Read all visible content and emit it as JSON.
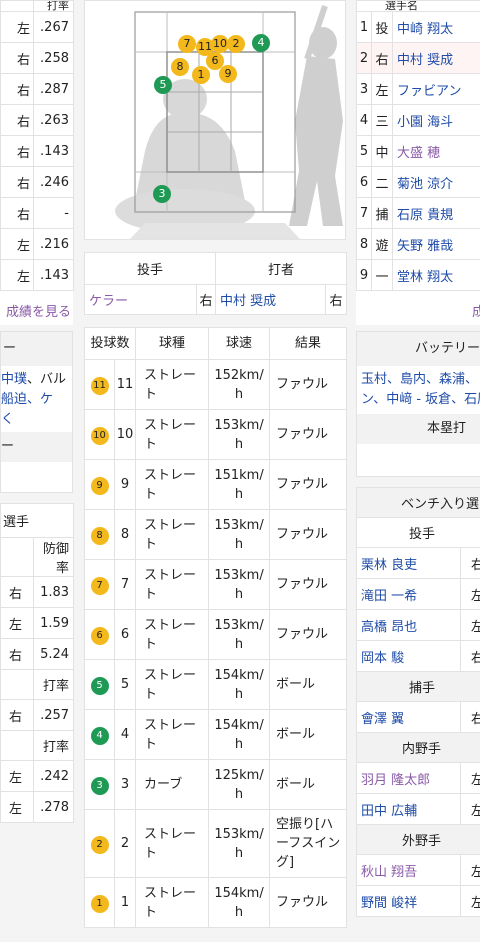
{
  "left_top": {
    "header": "打率",
    "rows": [
      {
        "hand": "左",
        "avg": ".267"
      },
      {
        "hand": "右",
        "avg": ".258"
      },
      {
        "hand": "右",
        "avg": ".287"
      },
      {
        "hand": "右",
        "avg": ".263"
      },
      {
        "hand": "右",
        "avg": ".143"
      },
      {
        "hand": "右",
        "avg": ".246"
      },
      {
        "hand": "右",
        "avg": "-"
      },
      {
        "hand": "左",
        "avg": ".216"
      },
      {
        "hand": "左",
        "avg": ".143"
      }
    ],
    "more": "成績を見る"
  },
  "left_battery": {
    "title": "ー",
    "line1_a": "中璞",
    "line1_b": "、バル",
    "line2": "船迫、ケ",
    "line3": "く",
    "line4": "ー"
  },
  "left_pitchers": {
    "title": "選手",
    "era_header": "防御率",
    "rows": [
      {
        "hand": "右",
        "val": "1.83"
      },
      {
        "hand": "左",
        "val": "1.59"
      },
      {
        "hand": "右",
        "val": "5.24"
      }
    ],
    "avg_header1": "打率",
    "rows2": [
      {
        "hand": "右",
        "val": ".257"
      }
    ],
    "avg_header2": "打率",
    "rows3": [
      {
        "hand": "左",
        "val": ".242"
      },
      {
        "hand": "左",
        "val": ".278"
      }
    ]
  },
  "zone": {
    "points": [
      {
        "n": "7",
        "c": "y"
      },
      {
        "n": "11",
        "c": "y"
      },
      {
        "n": "10",
        "c": "y"
      },
      {
        "n": "2",
        "c": "y"
      },
      {
        "n": "4",
        "c": "g"
      },
      {
        "n": "6",
        "c": "y"
      },
      {
        "n": "8",
        "c": "y"
      },
      {
        "n": "1",
        "c": "y"
      },
      {
        "n": "9",
        "c": "y"
      },
      {
        "n": "5",
        "c": "g"
      },
      {
        "n": "3",
        "c": "g"
      }
    ]
  },
  "matchup": {
    "pitcher_h": "投手",
    "batter_h": "打者",
    "pitcher": "ケラー",
    "pitcher_hand": "右",
    "batter": "中村 奨成",
    "batter_hand": "右"
  },
  "pitches": {
    "headers": [
      "投球数",
      "球種",
      "球速",
      "結果"
    ],
    "rows": [
      {
        "badge": "11",
        "color": "y",
        "num": "11",
        "kind": "ストレート",
        "speed": "152km/h",
        "result": "ファウル"
      },
      {
        "badge": "10",
        "color": "y",
        "num": "10",
        "kind": "ストレート",
        "speed": "153km/h",
        "result": "ファウル"
      },
      {
        "badge": "9",
        "color": "y",
        "num": "9",
        "kind": "ストレート",
        "speed": "151km/h",
        "result": "ファウル"
      },
      {
        "badge": "8",
        "color": "y",
        "num": "8",
        "kind": "ストレート",
        "speed": "153km/h",
        "result": "ファウル"
      },
      {
        "badge": "7",
        "color": "y",
        "num": "7",
        "kind": "ストレート",
        "speed": "153km/h",
        "result": "ファウル"
      },
      {
        "badge": "6",
        "color": "y",
        "num": "6",
        "kind": "ストレート",
        "speed": "153km/h",
        "result": "ファウル"
      },
      {
        "badge": "5",
        "color": "g",
        "num": "5",
        "kind": "ストレート",
        "speed": "154km/h",
        "result": "ボール"
      },
      {
        "badge": "4",
        "color": "g",
        "num": "4",
        "kind": "ストレート",
        "speed": "154km/h",
        "result": "ボール"
      },
      {
        "badge": "3",
        "color": "g",
        "num": "3",
        "kind": "カーブ",
        "speed": "125km/h",
        "result": "ボール"
      },
      {
        "badge": "2",
        "color": "y",
        "num": "2",
        "kind": "ストレート",
        "speed": "153km/h",
        "result": "空振り[ハーフスイング]"
      },
      {
        "badge": "1",
        "color": "y",
        "num": "1",
        "kind": "ストレート",
        "speed": "154km/h",
        "result": "ファウル"
      }
    ]
  },
  "lineup": {
    "header": "選手名",
    "rows": [
      {
        "n": "1",
        "pos": "投",
        "name": "中崎 翔太",
        "hl": false,
        "v": false
      },
      {
        "n": "2",
        "pos": "右",
        "name": "中村 奨成",
        "hl": true,
        "v": false
      },
      {
        "n": "3",
        "pos": "左",
        "name": "ファビアン",
        "hl": false,
        "v": false
      },
      {
        "n": "4",
        "pos": "三",
        "name": "小園 海斗",
        "hl": false,
        "v": false
      },
      {
        "n": "5",
        "pos": "中",
        "name": "大盛 穂",
        "hl": false,
        "v": true
      },
      {
        "n": "6",
        "pos": "二",
        "name": "菊池 涼介",
        "hl": false,
        "v": false
      },
      {
        "n": "7",
        "pos": "捕",
        "name": "石原 貴規",
        "hl": false,
        "v": false
      },
      {
        "n": "8",
        "pos": "遊",
        "name": "矢野 雅哉",
        "hl": false,
        "v": false
      },
      {
        "n": "9",
        "pos": "一",
        "name": "堂林 翔太",
        "hl": false,
        "v": false
      }
    ],
    "more": "成"
  },
  "battery": {
    "title": "バッテリー",
    "line1": "玉村、島内、森浦、",
    "line2": "ン、中﨑 - 坂倉、石原",
    "hr_title": "本塁打"
  },
  "bench": {
    "title": "ベンチ入り選",
    "pitcher_h": "投手",
    "pitchers": [
      {
        "name": "栗林 良吏",
        "hand": "右"
      },
      {
        "name": "滝田 一希",
        "hand": "左"
      },
      {
        "name": "高橋 昂也",
        "hand": "左"
      },
      {
        "name": "岡本 駿",
        "hand": "右"
      }
    ],
    "catcher_h": "捕手",
    "catchers": [
      {
        "name": "會澤 翼",
        "hand": "右"
      }
    ],
    "infield_h": "内野手",
    "infield": [
      {
        "name": "羽月 隆太郎",
        "hand": "左",
        "v": true
      },
      {
        "name": "田中 広輔",
        "hand": "左",
        "v": false
      }
    ],
    "outfield_h": "外野手",
    "outfield": [
      {
        "name": "秋山 翔吾",
        "hand": "左",
        "v": true
      },
      {
        "name": "野間 峻祥",
        "hand": "左",
        "v": false
      }
    ]
  },
  "colors": {
    "yellow": "#f2b81c",
    "green": "#1e9a55",
    "link": "#1f4ca8",
    "visited": "#8a5aa8"
  }
}
